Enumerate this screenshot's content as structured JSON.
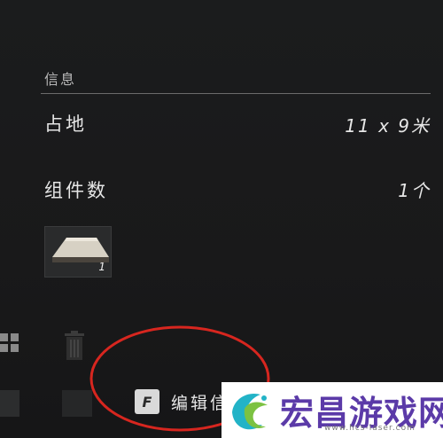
{
  "info_panel": {
    "section_title": "信息",
    "rows": [
      {
        "label": "占地",
        "value": "11 x 9米"
      },
      {
        "label": "组件数",
        "value": "1个"
      }
    ],
    "component": {
      "count": "1"
    }
  },
  "action_bar": {
    "key": "F",
    "label": "编辑信"
  },
  "annotation": {
    "color": "#d7261f"
  },
  "watermark": {
    "title": "宏昌游戏网",
    "url": "www.hcs-laser.com",
    "brand_color": "#5b3aa8",
    "logo_colors": [
      "#22b3c7",
      "#7cc242"
    ]
  }
}
